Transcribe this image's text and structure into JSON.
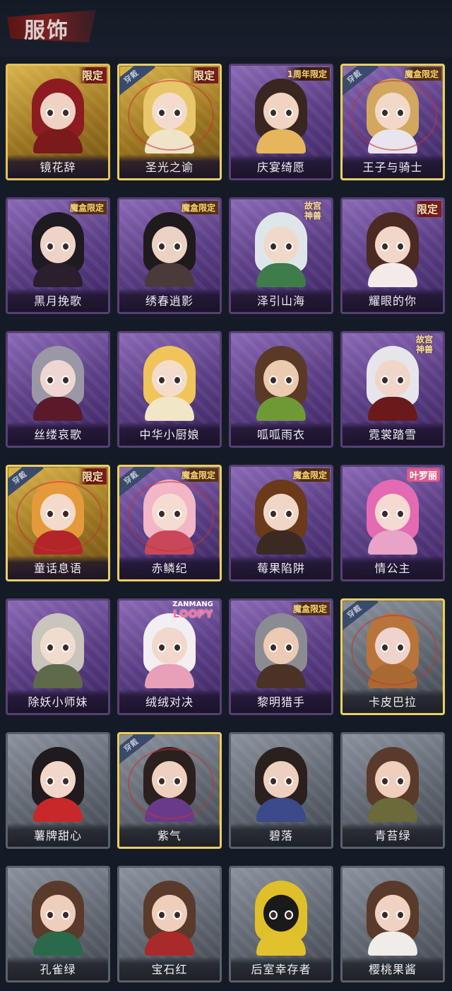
{
  "header": {
    "title": "服饰"
  },
  "equip_label": "穿戴",
  "cards": [
    {
      "name": "镜花辞",
      "rarity": "gold",
      "tag": "limit",
      "tag_text": "限定",
      "equipped": false,
      "hair": "#8c1c22",
      "body": "#7a1a1a",
      "skin": "#efd2c4"
    },
    {
      "name": "圣光之谕",
      "rarity": "gold",
      "tag": "limit",
      "tag_text": "限定",
      "equipped": true,
      "hair": "#e8c66a",
      "body": "#efe4c8",
      "skin": "#f3dccd"
    },
    {
      "name": "庆宴绮愿",
      "rarity": "purple",
      "tag": "anniv",
      "tag_text": "1周年限定",
      "equipped": false,
      "hair": "#3a2620",
      "body": "#e6b65c",
      "skin": "#f0d3c0"
    },
    {
      "name": "王子与骑士",
      "rarity": "purple",
      "tag": "box",
      "tag_text": "魔盒限定",
      "equipped": true,
      "hair": "#d2a860",
      "body": "#e9e4ee",
      "skin": "#f2d8c6"
    },
    {
      "name": "黑月挽歌",
      "rarity": "purple",
      "tag": "box",
      "tag_text": "魔盒限定",
      "equipped": false,
      "hair": "#1e1a22",
      "body": "#2a1f2c",
      "skin": "#efd3c7"
    },
    {
      "name": "绣春逍影",
      "rarity": "purple",
      "tag": "box",
      "tag_text": "魔盒限定",
      "equipped": false,
      "hair": "#1f1a1c",
      "body": "#4a3a3a",
      "skin": "#ecd2c2"
    },
    {
      "name": "泽引山海",
      "rarity": "purple",
      "tag": "gugong",
      "tag_text": "故宫",
      "tag_text2": "神兽",
      "equipped": false,
      "hair": "#dfe6ea",
      "body": "#3e7c4a",
      "skin": "#f1d9c9"
    },
    {
      "name": "耀眼的你",
      "rarity": "purple",
      "tag": "limit",
      "tag_text": "限定",
      "equipped": false,
      "hair": "#4a2a22",
      "body": "#f3ebe8",
      "skin": "#f2d6c8"
    },
    {
      "name": "丝缕哀歌",
      "rarity": "purple",
      "tag": "none",
      "equipped": false,
      "hair": "#9a98a6",
      "body": "#5a1a2a",
      "skin": "#efd6d2"
    },
    {
      "name": "中华小厨娘",
      "rarity": "purple",
      "tag": "none",
      "equipped": false,
      "hair": "#f0c45a",
      "body": "#f1e6c6",
      "skin": "#f4dccb"
    },
    {
      "name": "呱呱雨衣",
      "rarity": "purple",
      "tag": "none",
      "equipped": false,
      "hair": "#5a3a26",
      "body": "#6e9a36",
      "skin": "#eccab0"
    },
    {
      "name": "霓裳踏雪",
      "rarity": "purple",
      "tag": "gugong",
      "tag_text": "故宫",
      "tag_text2": "神兽",
      "equipped": false,
      "hair": "#e6e6ea",
      "body": "#6a1a1a",
      "skin": "#efd6c8"
    },
    {
      "name": "童话息语",
      "rarity": "gold",
      "tag": "limit",
      "tag_text": "限定",
      "equipped": true,
      "hair": "#e49a3a",
      "body": "#b2262a",
      "skin": "#f4dacb"
    },
    {
      "name": "赤鳞纪",
      "rarity": "purple",
      "tag": "box",
      "tag_text": "魔盒限定",
      "equipped": true,
      "hair": "#f2b6c6",
      "body": "#c8485a",
      "skin": "#f5dcd2"
    },
    {
      "name": "莓果陷阱",
      "rarity": "purple",
      "tag": "box",
      "tag_text": "魔盒限定",
      "equipped": false,
      "hair": "#6a3a1a",
      "body": "#3a2a22",
      "skin": "#f0d6c6"
    },
    {
      "name": "情公主",
      "rarity": "purple",
      "tag": "pink",
      "tag_text": "叶罗丽",
      "equipped": false,
      "hair": "#e46ab2",
      "body": "#e8a4c8",
      "skin": "#f4dad2"
    },
    {
      "name": "除妖小师妹",
      "rarity": "purple",
      "tag": "none",
      "equipped": false,
      "hair": "#c9c4bc",
      "body": "#5e6a4a",
      "skin": "#f0dccf"
    },
    {
      "name": "绒绒对决",
      "rarity": "purple",
      "tag": "loopy",
      "tag_text": "ZANMANG",
      "tag_text2": "LOOPY",
      "equipped": false,
      "hair": "#f3eef2",
      "body": "#e8a0b8",
      "skin": "#f2d8cc"
    },
    {
      "name": "黎明猎手",
      "rarity": "purple",
      "tag": "box",
      "tag_text": "魔盒限定",
      "equipped": false,
      "hair": "#8a8c92",
      "body": "#4a3226",
      "skin": "#eccab4"
    },
    {
      "name": "卡皮巴拉",
      "rarity": "gray",
      "tag": "none",
      "equipped": true,
      "hair": "#b8743a",
      "body": "#a86a32",
      "skin": "#eed4cc"
    },
    {
      "name": "薯牌甜心",
      "rarity": "gray",
      "tag": "none",
      "equipped": false,
      "hair": "#201a1e",
      "body": "#c8282a",
      "skin": "#f2d6c8"
    },
    {
      "name": "紫气",
      "rarity": "gray",
      "tag": "none",
      "equipped": true,
      "hair": "#2a201e",
      "body": "#6a3a8a",
      "skin": "#efd0be"
    },
    {
      "name": "碧落",
      "rarity": "gray",
      "tag": "none",
      "equipped": false,
      "hair": "#2a201e",
      "body": "#3a4a8a",
      "skin": "#efd0be"
    },
    {
      "name": "青苔绿",
      "rarity": "gray",
      "tag": "none",
      "equipped": false,
      "hair": "#5a3a2a",
      "body": "#6a6a3a",
      "skin": "#efcfbc"
    },
    {
      "name": "孔雀绿",
      "rarity": "gray",
      "tag": "none",
      "equipped": false,
      "hair": "#5a3a2a",
      "body": "#2a6a4a",
      "skin": "#efcfbc"
    },
    {
      "name": "宝石红",
      "rarity": "gray",
      "tag": "none",
      "equipped": false,
      "hair": "#5a3a2a",
      "body": "#a82a2a",
      "skin": "#efcfbc"
    },
    {
      "name": "后室幸存者",
      "rarity": "gray",
      "tag": "none",
      "equipped": false,
      "hair": "#e0c02a",
      "body": "#e2c22c",
      "skin": "#1a1a1a"
    },
    {
      "name": "樱桃果酱",
      "rarity": "gray",
      "tag": "none",
      "equipped": false,
      "hair": "#5a3a2a",
      "body": "#f0ecea",
      "skin": "#efd2c2"
    }
  ]
}
